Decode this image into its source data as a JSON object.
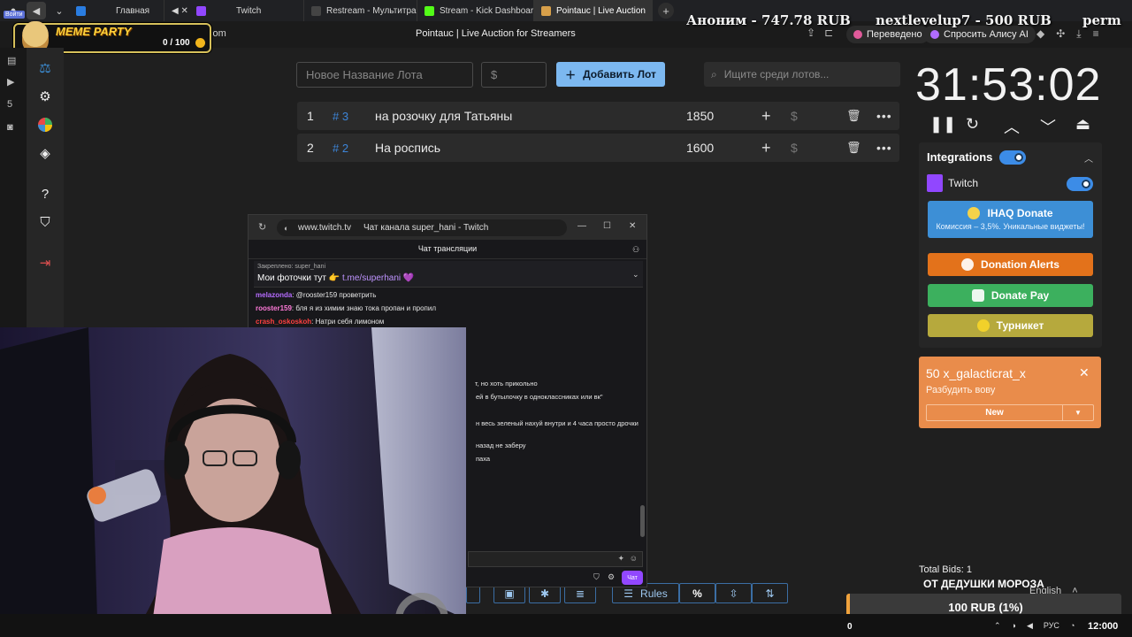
{
  "tabs": [
    {
      "label": "Главная",
      "active": false
    },
    {
      "label": "Twitch",
      "active": false
    },
    {
      "label": "Restream - Мультитрансл",
      "active": false
    },
    {
      "label": "Stream - Kick Dashboard",
      "active": false
    },
    {
      "label": "Pointauc | Live Auction",
      "active": true
    }
  ],
  "address": {
    "url_fragment": ".com",
    "page_title": "Pointauc | Live Auction for Streamers",
    "translated_label": "Переведено",
    "alice_label": "Спросить Алису AI"
  },
  "overlay": {
    "rail_login_label": "Войти",
    "meme_title": "MEME PARTY",
    "meme_count": "0 / 100",
    "ticker": [
      "Аноним - 747.78 RUB",
      "nextlevelup7 - 500 RUB",
      "perm"
    ]
  },
  "auction": {
    "lot_name_placeholder": "Новое Название Лота",
    "amount_placeholder": "$",
    "add_lot_label": "Добавить Лот",
    "search_placeholder": "Ищите среди лотов...",
    "lots": [
      {
        "pos": "1",
        "id": "# 3",
        "name": "на розочку для Татьяны",
        "amount": "1850"
      },
      {
        "pos": "2",
        "id": "# 2",
        "name": "На роспись",
        "amount": "1600"
      }
    ],
    "timer": "31:53:02"
  },
  "integrations": {
    "title": "Integrations",
    "twitch_label": "Twitch",
    "ihaq_label": "IHAQ Donate",
    "ihaq_sub": "Комиссия – 3,5%. Уникальные виджеты!",
    "donation_alerts": "Donation Alerts",
    "donate_pay": "Donate Pay",
    "turniket": "Турникет",
    "colors": {
      "ihaq": "#3d8fd6",
      "donation_alerts": "#e3721b",
      "donate_pay": "#3cb05e",
      "turniket": "#b6a93d"
    }
  },
  "bid": {
    "title": "50 x_galacticrat_x",
    "message": "Разбудить вову",
    "select_label": "New"
  },
  "footer": {
    "total_bids_label": "Total Bids:",
    "total_bids_value": "1",
    "grandpa_label": "ОТ ДЕДУШКИ МОРОЗА",
    "language": "English",
    "rub_label": "100 RUB (1%)",
    "toolbar_rules": "Rules",
    "toolbar_percent": "%"
  },
  "twitch_popup": {
    "url": "www.twitch.tv",
    "title": "Чат канала super_hani - Twitch",
    "chat_header": "Чат трансляции",
    "pinned_label": "Закреплено: super_hani",
    "pinned_text": "Мои фоточки тут 👉",
    "pinned_link": "t.me/superhani",
    "messages": [
      {
        "user": "melazonda",
        "text": ": @rooster159 проветрить",
        "color": "#b66cff"
      },
      {
        "user": "rooster159",
        "text": ": бля я из химии знаю тока пропан и пропил",
        "color": "#ff7ad9"
      },
      {
        "user": "crash_oskoskoh",
        "text": ": Натри себя лимоном",
        "color": "#ff4040"
      }
    ],
    "partial_lines": [
      "т, но хоть прикольно",
      "ей в бутылочку в одноклассниках или вк\"",
      "н весь зеленый нахуй внутри и 4 часа просто дрочки",
      "назад не заберу",
      "паха"
    ],
    "chat_button": "Чат"
  },
  "taskbar": {
    "counter": "0",
    "lang": "РУС",
    "time": "12:000"
  }
}
